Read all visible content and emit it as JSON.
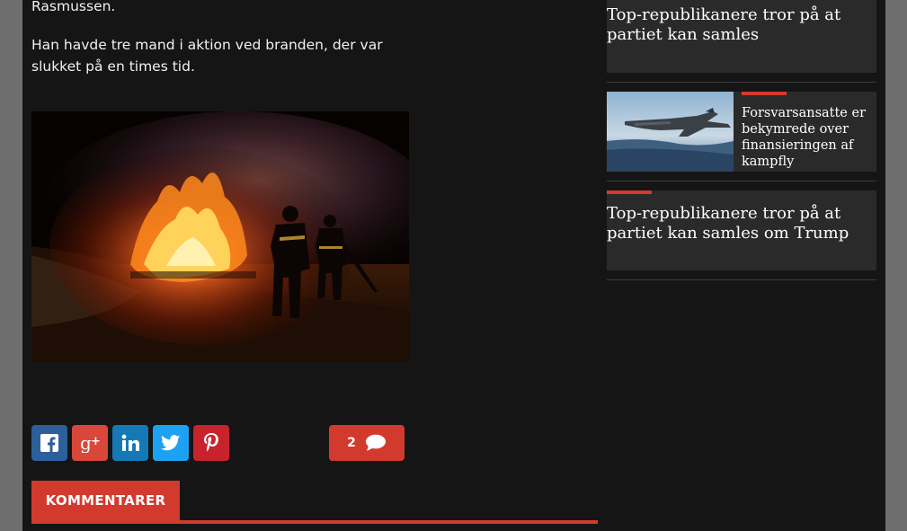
{
  "article": {
    "paragraph_end": "Rasmussen.",
    "paragraph2": "Han havde tre mand i aktion ved branden, der var slukket på en times tid."
  },
  "share": {
    "facebook": "facebook-icon",
    "googleplus": "googleplus-icon",
    "linkedin": "linkedin-icon",
    "twitter": "twitter-icon",
    "pinterest": "pinterest-icon"
  },
  "comments": {
    "count": "2",
    "header_label": "KOMMENTARER"
  },
  "sidebar": {
    "items": [
      {
        "title": "Top-republikanere tror på at partiet kan samles"
      },
      {
        "title": "Forsvarsansatte er bekymrede over finansieringen af kampfly"
      },
      {
        "title": "Top-republikanere tror på at partiet kan samles om Trump"
      }
    ]
  },
  "colors": {
    "accent": "#d23a2e",
    "page_bg": "#151515",
    "card_bg": "#2a2a2a",
    "outer_bg": "#6e6e6e"
  }
}
